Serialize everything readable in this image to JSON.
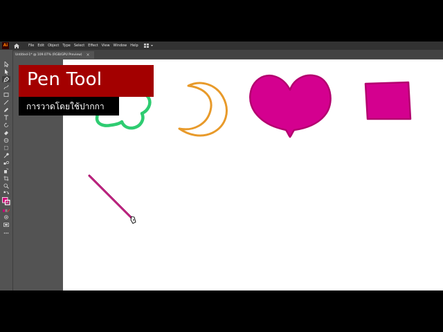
{
  "app": {
    "logo": "Ai",
    "menu": [
      "File",
      "Edit",
      "Object",
      "Type",
      "Select",
      "Effect",
      "View",
      "Window",
      "Help"
    ],
    "document_tab": {
      "label": "Untitled-1* @ 109.07% (RGB/GPU Preview)",
      "close": "×"
    },
    "fill_color": "#cc0077",
    "stroke_color": "#ffffff"
  },
  "overlay": {
    "title": "Pen Tool",
    "subtitle": "การวาดโดยใช้ปากกา",
    "title_bg": "#a30000",
    "subtitle_bg": "#000000"
  },
  "shapes": {
    "flower_color": "#2ecc71",
    "moon_color": "#e89a2a",
    "heart_color": "#d4008f",
    "heart_stroke": "#b3006f",
    "square_color": "#d4008f",
    "line_color": "#a0005f"
  }
}
